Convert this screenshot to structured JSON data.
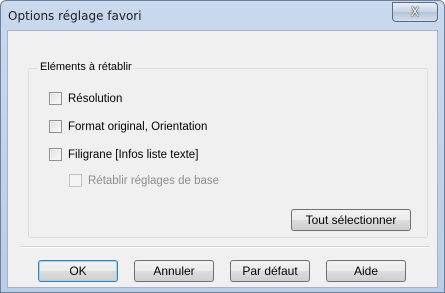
{
  "window": {
    "title": "Options réglage favori",
    "close_glyph": "X",
    "close_icon": "close-icon"
  },
  "group": {
    "legend": "Eléments à rétablir",
    "options": [
      {
        "label": "Résolution",
        "checked": false,
        "enabled": true
      },
      {
        "label": "Format original, Orientation",
        "checked": false,
        "enabled": true
      },
      {
        "label": "Filigrane [Infos liste texte]",
        "checked": false,
        "enabled": true
      },
      {
        "label": "Rétablir réglages de base",
        "checked": false,
        "enabled": false
      }
    ],
    "select_all_label": "Tout sélectionner"
  },
  "footer": {
    "ok_label": "OK",
    "cancel_label": "Annuler",
    "default_label": "Par défaut",
    "help_label": "Aide"
  }
}
